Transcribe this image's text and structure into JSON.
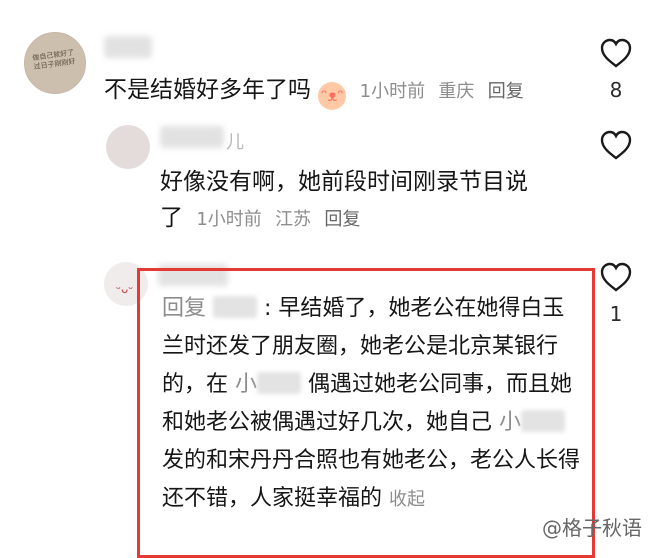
{
  "comments": [
    {
      "text": "不是结婚好多年了吗",
      "emoji": "ᵔᴥᵔ",
      "time": "1小时前",
      "location": "重庆",
      "reply_label": "回复",
      "likes": "8",
      "avatar_text": "做自己就好了 过日子刚刚好"
    },
    {
      "line1": "好像没有啊，她前段时间刚录节目说",
      "line2_prefix": "了",
      "time": "1小时前",
      "location": "江苏",
      "reply_label": "回复",
      "username_suffix": "儿"
    },
    {
      "reply_prefix": "回复",
      "colon_text": ": 早结婚了，她老公在她得白玉兰时还发了朋友圈，她老公是北京某银行的，在",
      "part2": "偶遇过她老公同事，而且她和她老公被偶遇过好几次，她自己",
      "part3": "发的和宋丹丹合照也有她老公，老公人长得还不错，人家挺幸福的",
      "collapse_label": "收起",
      "likes": "1",
      "mask1_char": "小",
      "mask2_char": "小"
    }
  ],
  "watermark": "@格子秋语"
}
